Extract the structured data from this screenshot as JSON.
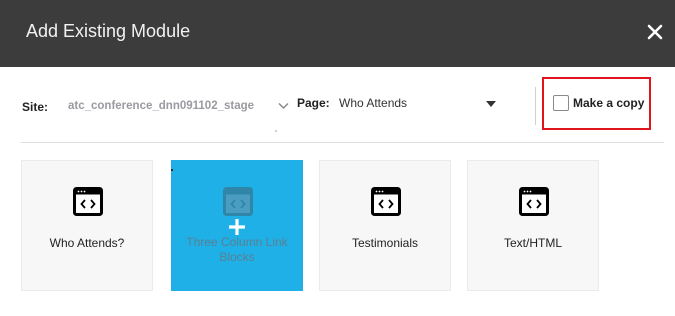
{
  "dialog": {
    "title": "Add Existing Module",
    "close_icon": "close-icon"
  },
  "toolbar": {
    "site_label": "Site:",
    "site_value": "atc_conference_dnn091102_stage",
    "page_label": "Page:",
    "page_value": "Who Attends",
    "copy_label": "Make a copy",
    "copy_checked": false
  },
  "modules": [
    {
      "label": "Who Attends?",
      "icon": "code-window-icon",
      "active": false
    },
    {
      "label": "Three Column Link Blocks",
      "icon": "code-window-icon",
      "active": true
    },
    {
      "label": "Testimonials",
      "icon": "code-window-icon",
      "active": false
    },
    {
      "label": "Text/HTML",
      "icon": "code-window-icon",
      "active": false
    }
  ],
  "colors": {
    "header_bg": "#3c3c3c",
    "active_tile": "#1eb0e6",
    "highlight_border": "#e0141c"
  }
}
